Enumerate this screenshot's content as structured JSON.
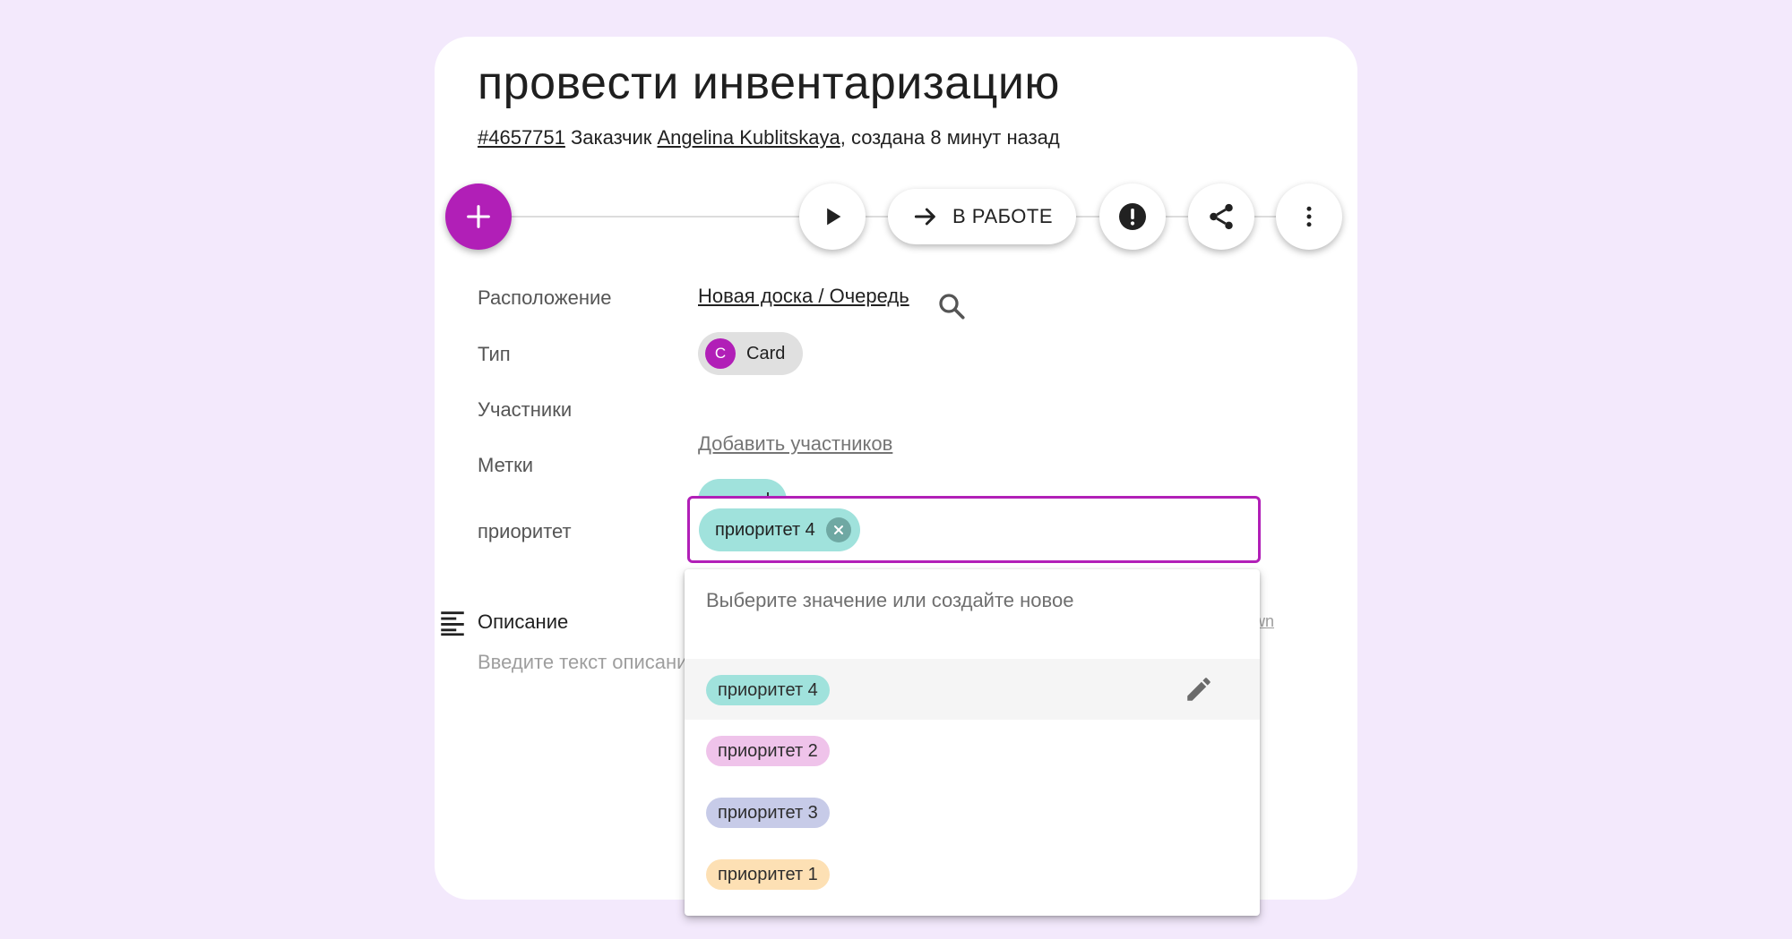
{
  "task": {
    "title": "провести инвентаризацию",
    "id": "#4657751",
    "customer_label": " Заказчик ",
    "customer_name": "Angelina Kublitskaya",
    "created_text": ", создана 8 минут назад"
  },
  "actions": {
    "status_label": "В РАБОТЕ"
  },
  "fields": {
    "location_label": "Расположение",
    "location_value": "Новая доска / Очередь",
    "type_label": "Тип",
    "type_avatar": "C",
    "type_value": "Card",
    "members_label": "Участники",
    "members_add": "Добавить участников",
    "tags_label": "Метки",
    "tag_value": "normal",
    "priority_label": "приоритет",
    "priority_value": "приоритет 4"
  },
  "description": {
    "title": "Описание",
    "placeholder": "Введите текст описания",
    "markdown_link": "wn"
  },
  "dropdown": {
    "hint": "Выберите значение или создайте новое",
    "options": [
      {
        "label": "приоритет 4",
        "color": "#a0e2dc"
      },
      {
        "label": "приоритет 2",
        "color": "#efc3ea"
      },
      {
        "label": "приоритет 3",
        "color": "#c7cbe8"
      },
      {
        "label": "приоритет 1",
        "color": "#fde0b4"
      }
    ]
  },
  "colors": {
    "accent": "#b11fb7",
    "background": "#f3e9fc"
  }
}
